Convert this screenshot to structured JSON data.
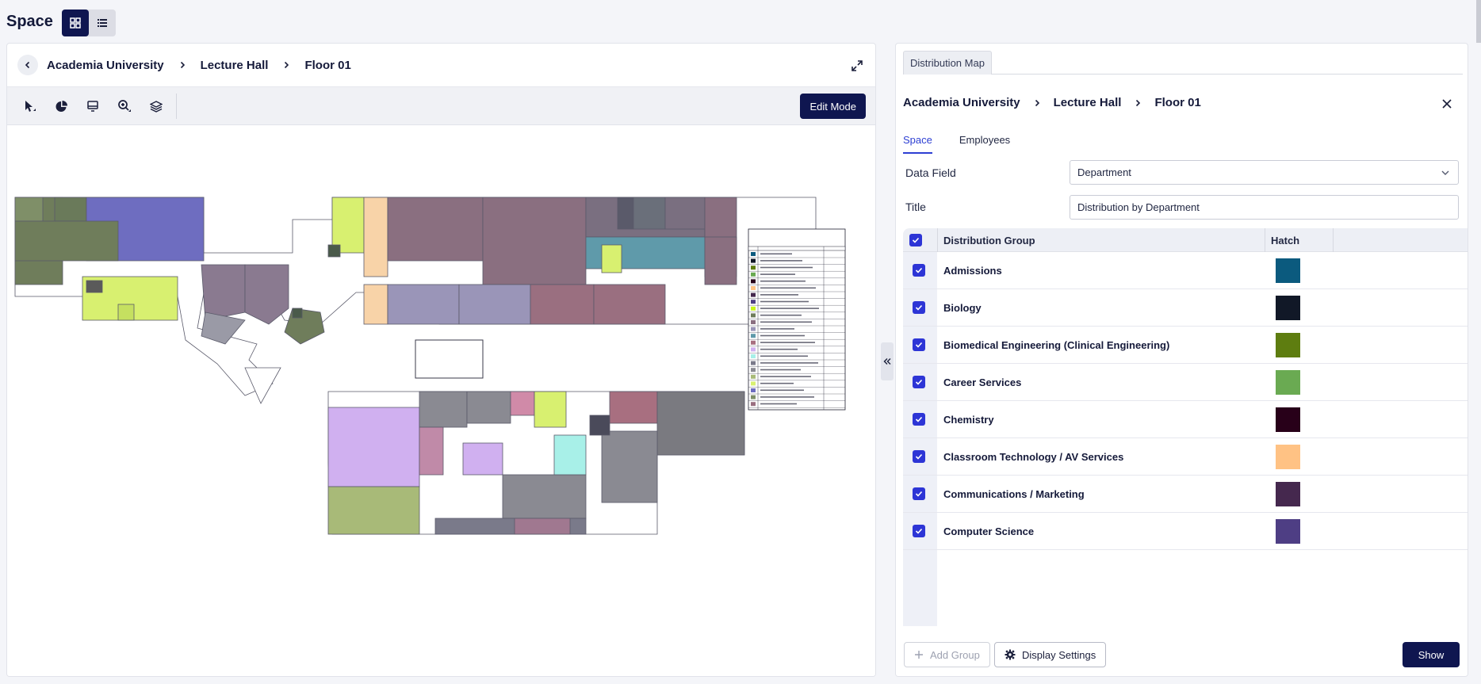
{
  "app": {
    "title": "Space",
    "views": [
      {
        "icon": "grid-view-icon",
        "active": true
      },
      {
        "icon": "list-view-icon",
        "active": false
      }
    ]
  },
  "viewer": {
    "breadcrumb": [
      "Academia University",
      "Lecture Hall",
      "Floor 01"
    ],
    "toolbar": {
      "tools": [
        "pointer-icon",
        "pie-chart-icon",
        "monitor-icon",
        "zoom-icon",
        "layers-icon"
      ],
      "edit_mode_label": "Edit Mode"
    }
  },
  "panel": {
    "tab_label": "Distribution Map",
    "breadcrumb": [
      "Academia University",
      "Lecture Hall",
      "Floor 01"
    ],
    "subtabs": [
      {
        "label": "Space",
        "active": true
      },
      {
        "label": "Employees",
        "active": false
      }
    ],
    "data_field": {
      "label": "Data Field",
      "value": "Department"
    },
    "title_field": {
      "label": "Title",
      "value": "Distribution by Department"
    },
    "table": {
      "headers": {
        "group": "Distribution Group",
        "hatch": "Hatch"
      },
      "rows": [
        {
          "name": "Admissions",
          "color": "#0b5a7e",
          "checked": true
        },
        {
          "name": "Biology",
          "color": "#111827",
          "checked": true
        },
        {
          "name": "Biomedical Engineering (Clinical Engineering)",
          "color": "#5e7d10",
          "checked": true
        },
        {
          "name": "Career Services",
          "color": "#6aaa52",
          "checked": true
        },
        {
          "name": "Chemistry",
          "color": "#280019",
          "checked": true
        },
        {
          "name": "Classroom Technology / AV Services",
          "color": "#ffc284",
          "checked": true
        },
        {
          "name": "Communications / Marketing",
          "color": "#45284e",
          "checked": true
        },
        {
          "name": "Computer Science",
          "color": "#4e3e84",
          "checked": true
        }
      ],
      "next_color": "#c8f51a"
    },
    "buttons": {
      "add_group": "Add Group",
      "display_settings": "Display Settings",
      "show": "Show"
    }
  }
}
